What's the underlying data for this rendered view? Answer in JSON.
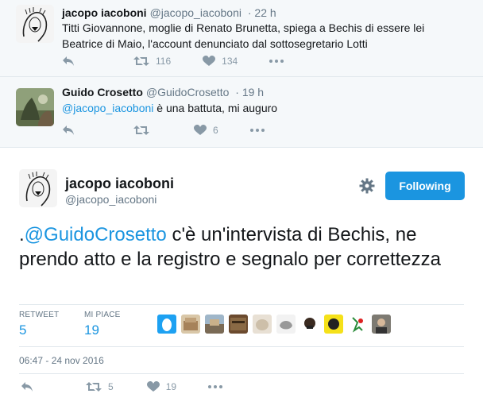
{
  "context_tweets": [
    {
      "name": "jacopo iacoboni",
      "handle": "@jacopo_iacoboni",
      "time": "· 22 h",
      "text": "Titti Giovannone, moglie di Renato Brunetta, spiega a Bechis di essere lei Beatrice di Maio, l'account denunciato dal sottosegretario Lotti",
      "retweets": "116",
      "likes": "134"
    },
    {
      "name": "Guido Crosetto",
      "handle": "@GuidoCrosetto",
      "time": "· 19 h",
      "mention": "@jacopo_iacoboni",
      "text": " è una battuta, mi auguro",
      "retweets": "",
      "likes": "6"
    }
  ],
  "main_tweet": {
    "name": "jacopo iacoboni",
    "handle": "@jacopo_iacoboni",
    "follow_label": "Following",
    "text_prefix": ".",
    "mention": "@GuidoCrosetto",
    "text_rest": " c'è un'intervista di Bechis, ne prendo atto e la registro e segnalo per correttezza",
    "retweet_label": "RETWEET",
    "retweet_count": "5",
    "likes_label": "MI PIACE",
    "likes_count": "19",
    "timestamp": "06:47 - 24 nov 2016",
    "action_retweets": "5",
    "action_likes": "19"
  },
  "colors": {
    "accent": "#1b95e0",
    "muted": "#8899a6",
    "context_bg": "#f5f8fa"
  },
  "icons": [
    "reply-icon",
    "retweet-icon",
    "heart-icon",
    "more-icon",
    "gear-icon"
  ]
}
